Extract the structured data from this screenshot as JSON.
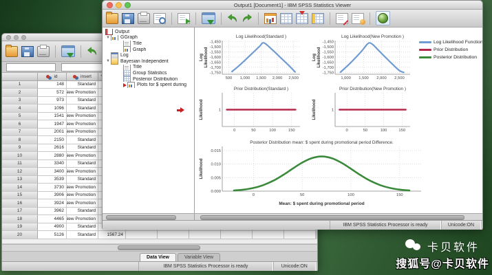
{
  "viewer_window": {
    "title": "Output1 [Document1] - IBM SPSS Statistics Viewer",
    "toolbar": {
      "groups": [
        [
          "open",
          "save",
          "print",
          "preview"
        ],
        [
          "export"
        ],
        [
          "goto-data"
        ],
        [
          "undo",
          "redo"
        ],
        [
          "chart",
          "table",
          "insert-rows",
          "pivot-table"
        ],
        [
          "edit-outline",
          "edit-output"
        ],
        [
          "show-tree"
        ]
      ]
    },
    "outline": {
      "items": [
        {
          "label": "Output",
          "level": 0,
          "icon": "output"
        },
        {
          "label": "GGraph",
          "level": 1,
          "icon": "ggraph",
          "expanded": true
        },
        {
          "label": "Title",
          "level": 2,
          "icon": "title"
        },
        {
          "label": "Graph",
          "level": 2,
          "icon": "graph"
        },
        {
          "label": "Log",
          "level": 1,
          "icon": "log"
        },
        {
          "label": "Bayesian Independent",
          "level": 1,
          "icon": "bayes",
          "expanded": true
        },
        {
          "label": "Title",
          "level": 2,
          "icon": "title"
        },
        {
          "label": "Group Statistics",
          "level": 2,
          "icon": "stats"
        },
        {
          "label": "Posterior Distribution",
          "level": 2,
          "icon": "stats"
        },
        {
          "label": "Plots for $ spent during",
          "level": 2,
          "icon": "plots",
          "selected": true
        }
      ]
    },
    "status": {
      "processor": "IBM SPSS Statistics Processor is ready",
      "unicode": "Unicode:ON"
    }
  },
  "data_window": {
    "toolbar": {
      "groups": [
        [
          "open",
          "save",
          "print"
        ],
        [
          "goto-data"
        ],
        [
          "undo",
          "redo"
        ]
      ]
    },
    "table": {
      "columns": [
        "id",
        "insert"
      ],
      "rows": [
        [
          "1",
          "148",
          "Standard",
          ""
        ],
        [
          "2",
          "572",
          "New Promotion",
          ""
        ],
        [
          "3",
          "973",
          "Standard",
          ""
        ],
        [
          "4",
          "1096",
          "Standard",
          ""
        ],
        [
          "5",
          "1541",
          "New Promotion",
          ""
        ],
        [
          "6",
          "1947",
          "New Promotion",
          ""
        ],
        [
          "7",
          "2001",
          "New Promotion",
          ""
        ],
        [
          "8",
          "2150",
          "Standard",
          ""
        ],
        [
          "9",
          "2616",
          "Standard",
          ""
        ],
        [
          "10",
          "2880",
          "New Promotion",
          ""
        ],
        [
          "11",
          "3340",
          "Standard",
          ""
        ],
        [
          "12",
          "3400",
          "New Promotion",
          ""
        ],
        [
          "13",
          "3539",
          "Standard",
          ""
        ],
        [
          "14",
          "3730",
          "New Promotion",
          ""
        ],
        [
          "15",
          "3906",
          "New Promotion",
          ""
        ],
        [
          "16",
          "3924",
          "New Promotion",
          ""
        ],
        [
          "17",
          "3962",
          "Standard",
          ""
        ],
        [
          "18",
          "4465",
          "New Promotion",
          ""
        ],
        [
          "19",
          "4900",
          "Standard",
          ""
        ],
        [
          "20",
          "5126",
          "Standard",
          "1567.24"
        ]
      ]
    },
    "tabs": [
      {
        "label": "Data View",
        "active": true
      },
      {
        "label": "Variable View",
        "active": false
      }
    ],
    "status": {
      "processor": "IBM SPSS Statistics Processor is ready",
      "unicode": "Unicode:ON"
    }
  },
  "watermark": {
    "line1": "卡贝软件",
    "line2": "搜狐号@卡贝软件"
  },
  "chart_legend": {
    "position": "right-of-top-charts",
    "entries": [
      {
        "label": "Log Likelihood Function",
        "color": "#6f9bd1"
      },
      {
        "label": "Prior Distribution",
        "color": "#b5284c"
      },
      {
        "label": "Posterior Distribution",
        "color": "#3b8a3c"
      }
    ]
  },
  "chart_data": [
    {
      "id": "log_std",
      "type": "line",
      "title": "Log Likelihood(Standard )",
      "ylabel": "Log Likelihood",
      "xlabel": "",
      "color": "#6f9bd1",
      "stroke_width": 2.2,
      "xlim": [
        300,
        2700
      ],
      "ylim": [
        -1768,
        -1440
      ],
      "xticks": [
        500,
        1000,
        1500,
        2000,
        2500
      ],
      "xtick_labels": [
        "500",
        "1,000",
        "1,500",
        "2,000",
        "2,500"
      ],
      "yticks": [
        -1450,
        -1500,
        -1550,
        -1600,
        -1650,
        -1700,
        -1750
      ],
      "ytick_labels": [
        "-1,450",
        "-1,500",
        "-1,550",
        "-1,600",
        "-1,650",
        "-1,700",
        "-1,750"
      ],
      "points": [
        [
          600,
          -1742
        ],
        [
          800,
          -1690
        ],
        [
          1000,
          -1632
        ],
        [
          1200,
          -1572
        ],
        [
          1350,
          -1527
        ],
        [
          1475,
          -1488
        ],
        [
          1550,
          -1462
        ],
        [
          1640,
          -1472
        ],
        [
          1760,
          -1505
        ],
        [
          1920,
          -1552
        ],
        [
          2120,
          -1612
        ],
        [
          2330,
          -1675
        ],
        [
          2550,
          -1746
        ]
      ]
    },
    {
      "id": "log_new",
      "type": "line",
      "title": "Log Likelihood(New Promotion )",
      "ylabel": "Log Likelihood",
      "xlabel": "",
      "color": "#6f9bd1",
      "stroke_width": 2.2,
      "xlim": [
        700,
        2800
      ],
      "ylim": [
        -1768,
        -1440
      ],
      "xticks": [
        1000,
        1500,
        2000,
        2500
      ],
      "xtick_labels": [
        "1,000",
        "1,500",
        "2,000",
        "2,500"
      ],
      "yticks": [
        -1450,
        -1500,
        -1550,
        -1600,
        -1650,
        -1700,
        -1750
      ],
      "ytick_labels": [
        "-1,450",
        "-1,500",
        "-1,550",
        "-1,600",
        "-1,650",
        "-1,700",
        "-1,750"
      ],
      "points": [
        [
          850,
          -1748
        ],
        [
          1050,
          -1685
        ],
        [
          1250,
          -1615
        ],
        [
          1450,
          -1540
        ],
        [
          1580,
          -1483
        ],
        [
          1660,
          -1462
        ],
        [
          1760,
          -1480
        ],
        [
          1900,
          -1530
        ],
        [
          2100,
          -1600
        ],
        [
          2300,
          -1668
        ],
        [
          2500,
          -1732
        ],
        [
          2620,
          -1750
        ]
      ]
    },
    {
      "id": "prior_std",
      "type": "line",
      "title": "Prior Distribution(Standard )",
      "ylabel": "Likelihood",
      "xlabel": "",
      "color": "#b5284c",
      "stroke_width": 2.5,
      "xlim": [
        -32,
        172
      ],
      "ylim": [
        0,
        2
      ],
      "xticks": [
        0,
        50,
        100,
        150
      ],
      "xtick_labels": [
        "0",
        "50",
        "100",
        "150"
      ],
      "yticks": [
        1
      ],
      "ytick_labels": [
        "1"
      ],
      "points": [
        [
          -20,
          1
        ],
        [
          160,
          1
        ]
      ]
    },
    {
      "id": "prior_new",
      "type": "line",
      "title": "Prior Distribution(New Promotion )",
      "ylabel": "Likelihood",
      "xlabel": "",
      "color": "#b5284c",
      "stroke_width": 2.5,
      "xlim": [
        -32,
        172
      ],
      "ylim": [
        0,
        2
      ],
      "xticks": [
        0,
        50,
        100,
        150
      ],
      "xtick_labels": [
        "0",
        "50",
        "100",
        "150"
      ],
      "yticks": [
        1
      ],
      "ytick_labels": [
        "1"
      ],
      "points": [
        [
          -20,
          1
        ],
        [
          160,
          1
        ]
      ]
    },
    {
      "id": "posterior",
      "type": "line",
      "title": "Posterior Distribution mean: $ spent during promotional period Difference.",
      "ylabel": "Likelihood",
      "xlabel": "Mean: $ spent during promotional period",
      "color": "#3b8a3c",
      "stroke_width": 2.6,
      "xlim": [
        -32,
        172
      ],
      "ylim": [
        0,
        0.0165
      ],
      "xticks": [
        0,
        50,
        100,
        150
      ],
      "xtick_labels": [
        "0",
        "50",
        "100",
        "150"
      ],
      "yticks": [
        0,
        0.005,
        0.01,
        0.015
      ],
      "ytick_labels": [
        "0.000",
        "0.005",
        "0.010",
        "0.015"
      ],
      "points": [
        [
          -20,
          0.00025
        ],
        [
          -10,
          0.00056
        ],
        [
          0,
          0.00117
        ],
        [
          10,
          0.00222
        ],
        [
          20,
          0.00377
        ],
        [
          30,
          0.00586
        ],
        [
          40,
          0.00825
        ],
        [
          50,
          0.01053
        ],
        [
          60,
          0.01219
        ],
        [
          70,
          0.0128
        ],
        [
          80,
          0.01219
        ],
        [
          90,
          0.01053
        ],
        [
          100,
          0.00825
        ],
        [
          110,
          0.00586
        ],
        [
          120,
          0.00377
        ],
        [
          130,
          0.00222
        ],
        [
          140,
          0.00117
        ],
        [
          150,
          0.00056
        ],
        [
          160,
          0.00025
        ]
      ]
    }
  ]
}
